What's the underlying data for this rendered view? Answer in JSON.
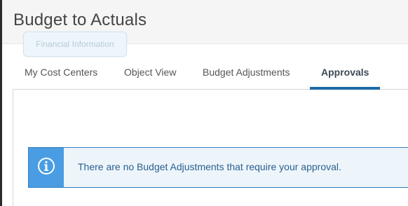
{
  "page": {
    "title": "Budget to Actuals",
    "tooltip": "Financial Information"
  },
  "tabs": [
    {
      "label": "My Cost Centers",
      "active": false
    },
    {
      "label": "Object View",
      "active": false
    },
    {
      "label": "Budget Adjustments",
      "active": false
    },
    {
      "label": "Approvals",
      "active": true
    }
  ],
  "alert": {
    "icon": "info-icon",
    "message": "There are no Budget Adjustments that require your approval."
  },
  "colors": {
    "accent": "#1e6aa8",
    "alert_icon_bg": "#4a9de3",
    "alert_bg": "#edf5fb",
    "alert_text": "#2a5f8e"
  }
}
